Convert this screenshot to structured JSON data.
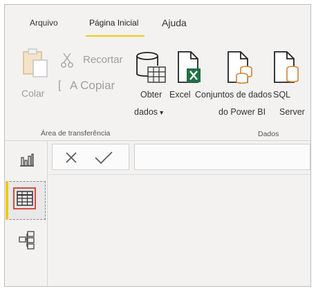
{
  "tabs": [
    {
      "label": "Arquivo"
    },
    {
      "label": "Página Inicial",
      "active": true
    },
    {
      "label": "Ajuda"
    }
  ],
  "clipboard": {
    "paste_label": "Colar",
    "cut_label": "Recortar",
    "copy_label": "A Copiar",
    "copy_prefix": "[",
    "group_label": "Área de transferência"
  },
  "data_group": {
    "get_data_line1": "Obter",
    "get_data_line2": "dados",
    "excel_label": "Excel",
    "datasets_line1": "Conjuntos de dados",
    "datasets_line2": "do Power BI",
    "sql_line1": "SQL",
    "sql_line2": "Server",
    "group_label": "Dados"
  },
  "nav": {
    "items": [
      "report-view",
      "data-view",
      "model-view"
    ],
    "active": "data-view"
  },
  "colors": {
    "accent": "#f2c811",
    "highlight": "#e0463c",
    "excel_green": "#1e7145",
    "db_orange": "#d9822b"
  }
}
